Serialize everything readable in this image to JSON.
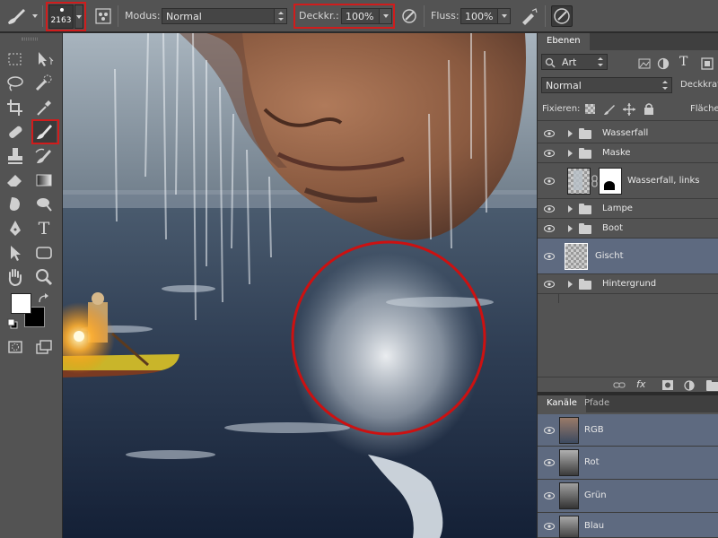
{
  "options_bar": {
    "brush_size": "2163",
    "mode_label": "Modus:",
    "mode_value": "Normal",
    "opacity_label": "Deckkr.:",
    "opacity_value": "100%",
    "flow_label": "Fluss:",
    "flow_value": "100%",
    "highlight_color": "#d01c1c"
  },
  "toolbar": {
    "tools": [
      "marquee-icon",
      "move-icon",
      "lasso-icon",
      "quick-select-icon",
      "crop-icon",
      "eyedropper-icon",
      "healing-brush-icon",
      "brush-icon",
      "stamp-icon",
      "history-brush-icon",
      "eraser-icon",
      "gradient-icon",
      "blur-icon",
      "dodge-icon",
      "pen-icon",
      "type-icon",
      "path-select-icon",
      "shape-icon",
      "hand-icon",
      "zoom-icon"
    ],
    "type_glyph": "T",
    "foreground_color": "#ffffff",
    "background_color": "#000000"
  },
  "layers_panel": {
    "tab": "Ebenen",
    "filter_value": "Art",
    "filter_type_glyph": "T",
    "blend_mode": "Normal",
    "opacity_label": "Deckkraft",
    "lock_label": "Fixieren:",
    "fill_label": "Fläche",
    "layers": [
      {
        "name": "Wasserfall",
        "kind": "group",
        "selected": false
      },
      {
        "name": "Maske",
        "kind": "group",
        "selected": false
      },
      {
        "name": "Wasserfall, links",
        "kind": "masked",
        "selected": false
      },
      {
        "name": "Lampe",
        "kind": "group",
        "selected": false
      },
      {
        "name": "Boot",
        "kind": "group",
        "selected": false
      },
      {
        "name": "Gischt",
        "kind": "pixel",
        "selected": true
      },
      {
        "name": "Hintergrund",
        "kind": "group",
        "selected": false
      }
    ],
    "fx_label": "fx",
    "selected_color": "#5e6a80"
  },
  "channels_panel": {
    "tabs": [
      "Kanäle",
      "Pfade"
    ],
    "channels": [
      "RGB",
      "Rot",
      "Grün",
      "Blau"
    ]
  },
  "canvas": {
    "annotation_color": "#cc1111"
  }
}
